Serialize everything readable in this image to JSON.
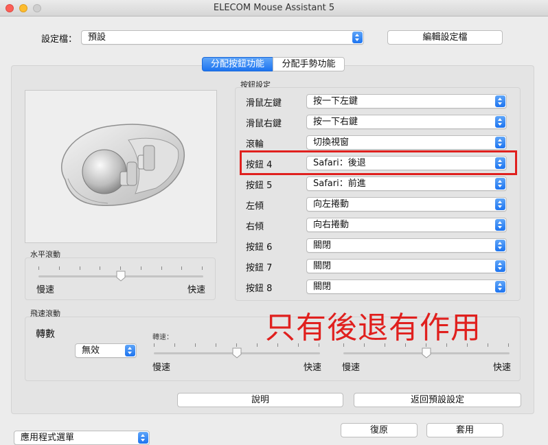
{
  "window": {
    "title": "ELECOM Mouse Assistant 5"
  },
  "profile": {
    "label": "設定檔：",
    "value": "預設",
    "edit_button": "編輯設定檔"
  },
  "tabs": [
    {
      "label": "分配按鈕功能"
    },
    {
      "label": "分配手勢功能"
    }
  ],
  "button_settings": {
    "heading": "按鈕設定",
    "rows": [
      {
        "label": "滑鼠左鍵",
        "value": "按一下左鍵"
      },
      {
        "label": "滑鼠右鍵",
        "value": "按一下右鍵"
      },
      {
        "label": "滾輪",
        "value": "切換視窗"
      },
      {
        "label": "按鈕 4",
        "value": "Safari：後退"
      },
      {
        "label": "按鈕 5",
        "value": "Safari：前進"
      },
      {
        "label": "左傾",
        "value": "向左捲動"
      },
      {
        "label": "右傾",
        "value": "向右捲動"
      },
      {
        "label": "按鈕 6",
        "value": "關閉"
      },
      {
        "label": "按鈕 7",
        "value": "關閉"
      },
      {
        "label": "按鈕 8",
        "value": "關閉"
      }
    ],
    "highlight_color": "#e0201e"
  },
  "horizontal_scroll": {
    "heading": "水平滾動",
    "slow": "慢速",
    "fast": "快速",
    "level": 0.5
  },
  "fly_scroll": {
    "heading": "飛速滾動",
    "rotation_label": "轉數",
    "rotation_value": "無效",
    "speed_label": "轉速：",
    "slider1": {
      "slow": "慢速",
      "fast": "快速",
      "level": 0.5
    },
    "slider2": {
      "slow": "慢速",
      "fast": "快速",
      "level": 0.5
    }
  },
  "annotation": {
    "text": "只有後退有作用",
    "color": "#e0201e"
  },
  "footer": {
    "help_button": "說明",
    "reset_default_button": "返回預設設定",
    "app_select": "應用程式選單",
    "restore_button": "復原",
    "apply_button": "套用"
  },
  "accent_color": "#1d74f0"
}
